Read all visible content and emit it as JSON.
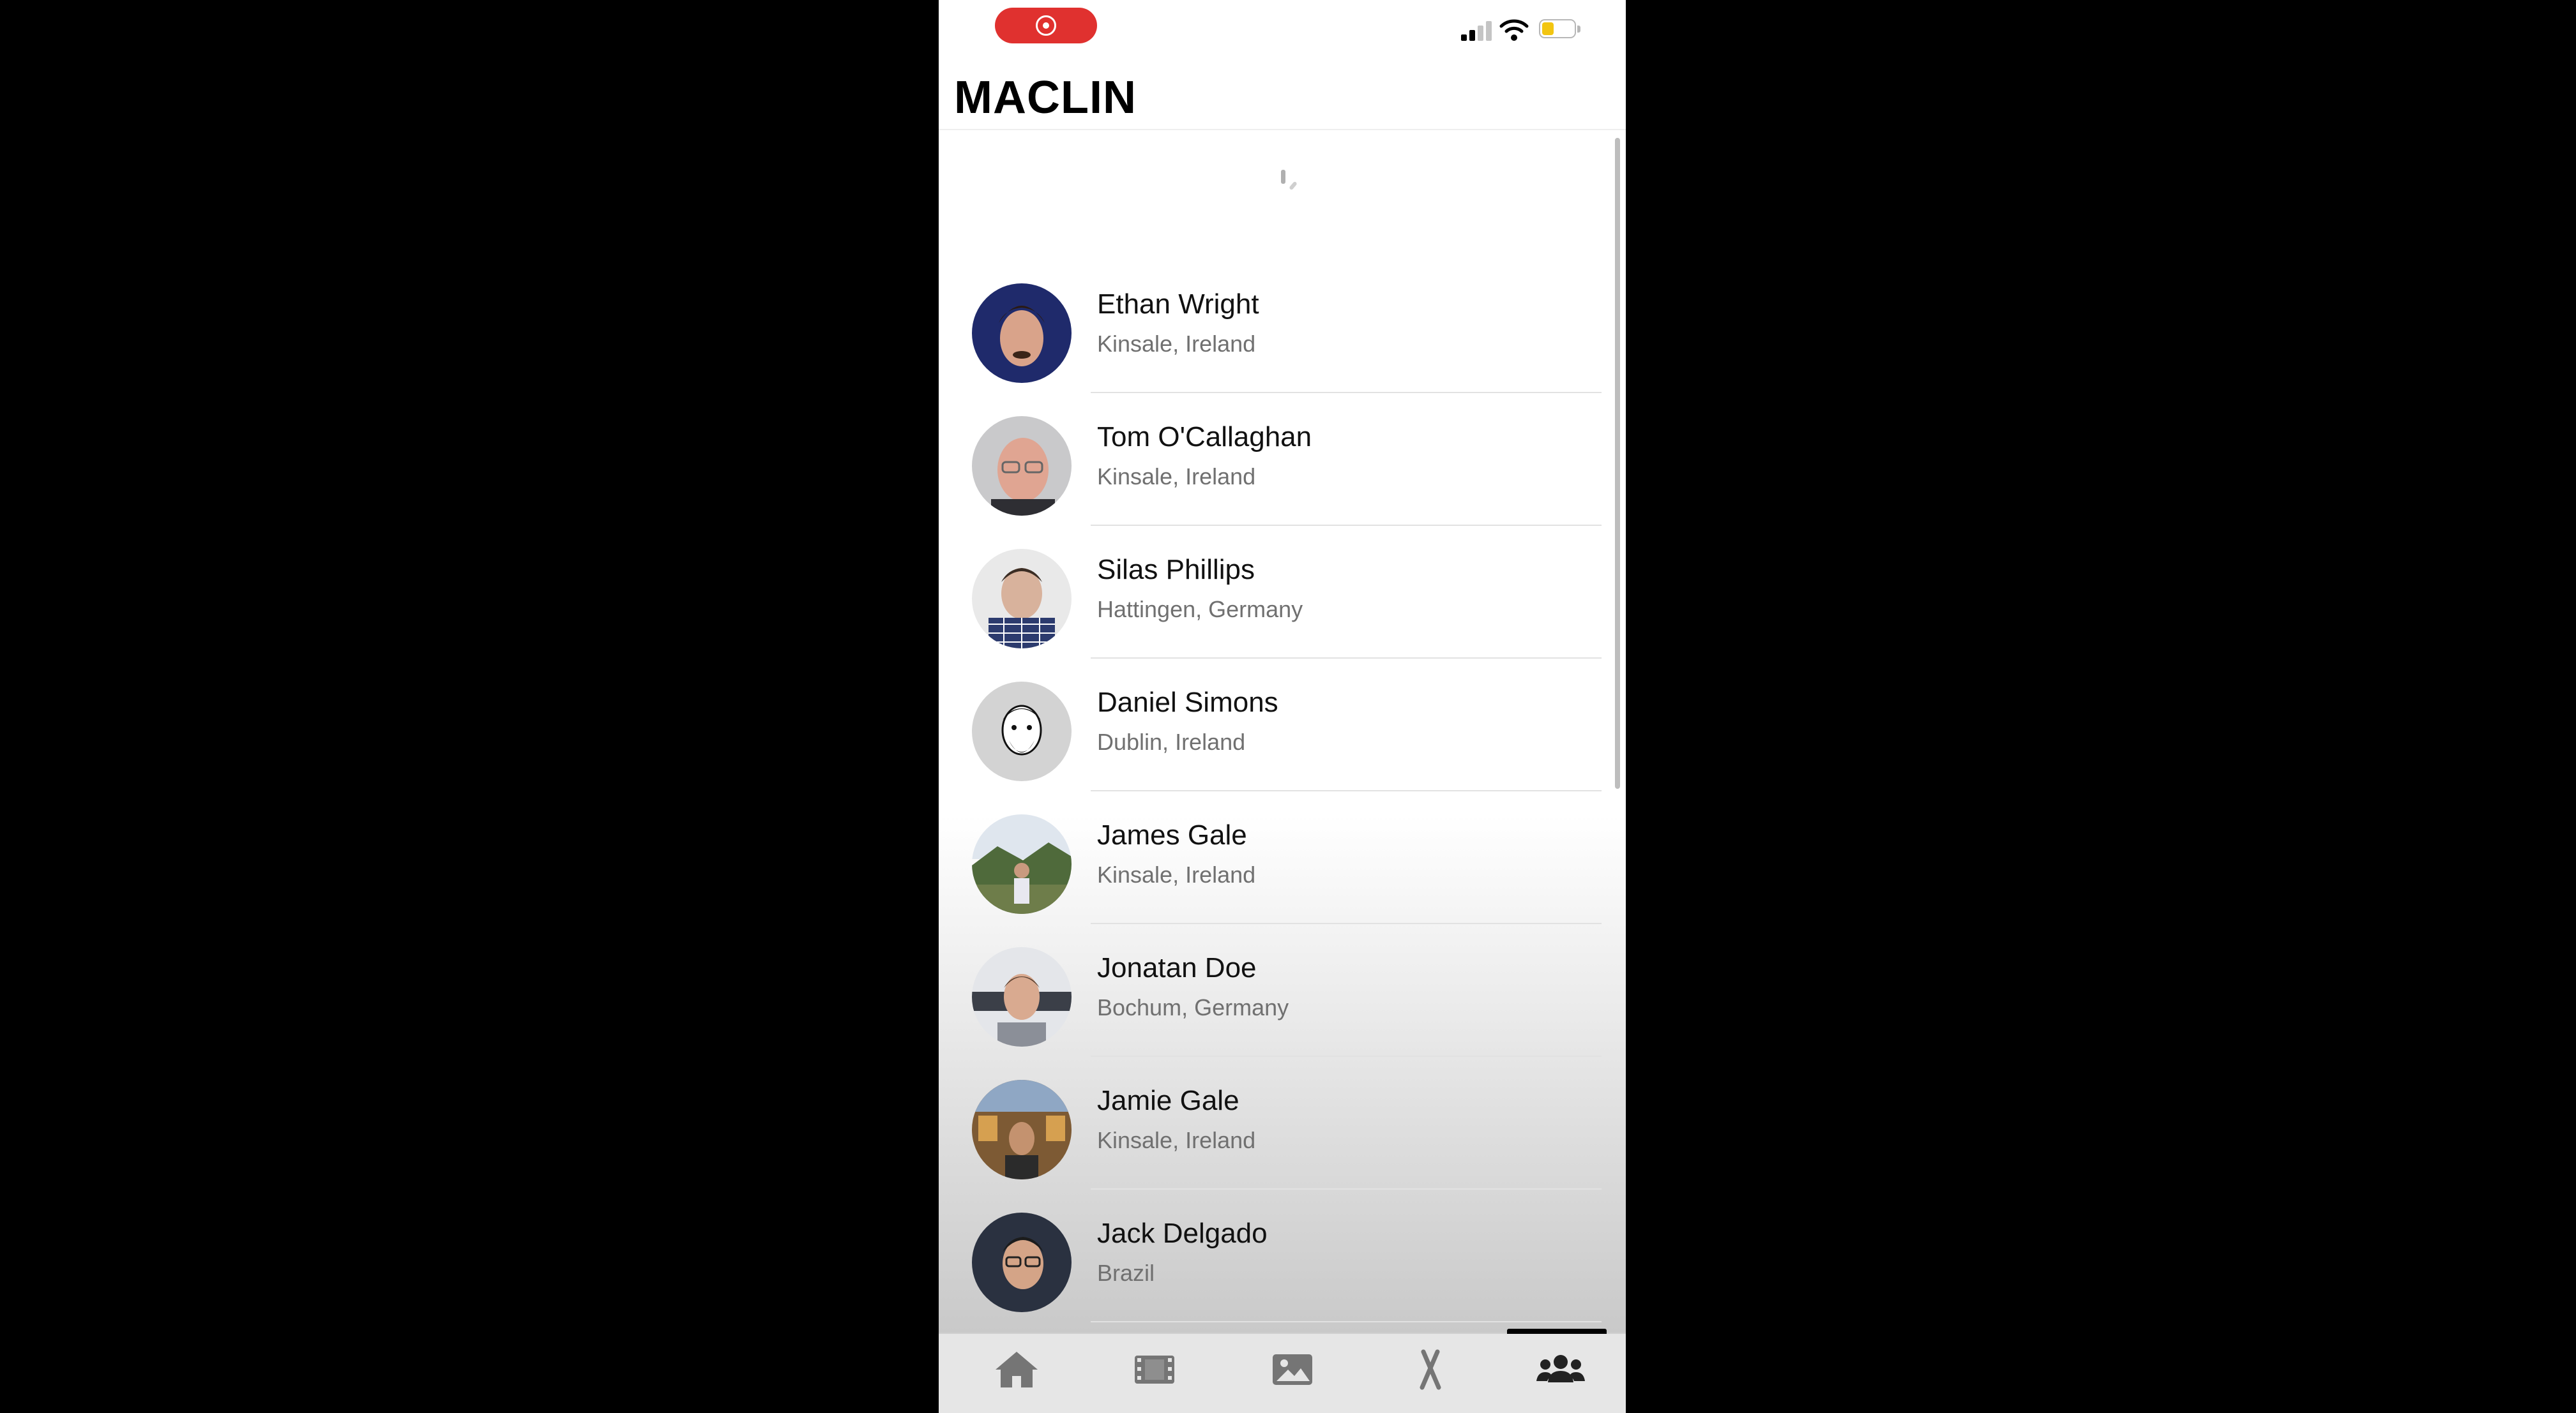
{
  "status_bar": {
    "recording_indicator": "screen-recording-icon",
    "signal": "signal-icon",
    "wifi": "wifi-icon",
    "battery": "battery-icon",
    "colors": {
      "recording": "#e0312f",
      "battery_fill": "#f2c511"
    }
  },
  "header": {
    "title": "MACLIN"
  },
  "loading": {
    "indicator": "spinner-icon"
  },
  "contacts": [
    {
      "name": "Ethan Wright",
      "location": "Kinsale, Ireland"
    },
    {
      "name": "Tom O'Callaghan",
      "location": "Kinsale, Ireland"
    },
    {
      "name": "Silas Phillips",
      "location": "Hattingen, Germany"
    },
    {
      "name": "Daniel Simons",
      "location": "Dublin, Ireland"
    },
    {
      "name": "James Gale",
      "location": "Kinsale, Ireland"
    },
    {
      "name": "Jonatan Doe",
      "location": "Bochum, Germany"
    },
    {
      "name": "Jamie Gale",
      "location": "Kinsale, Ireland"
    },
    {
      "name": "Jack Delgado",
      "location": "Brazil"
    }
  ],
  "tab_bar": {
    "tabs": [
      {
        "icon": "home-icon"
      },
      {
        "icon": "film-icon"
      },
      {
        "icon": "image-icon"
      },
      {
        "icon": "crossed-tools-icon"
      },
      {
        "icon": "people-icon",
        "active": true
      }
    ],
    "active_color": "#222222",
    "inactive_color": "#757575"
  }
}
